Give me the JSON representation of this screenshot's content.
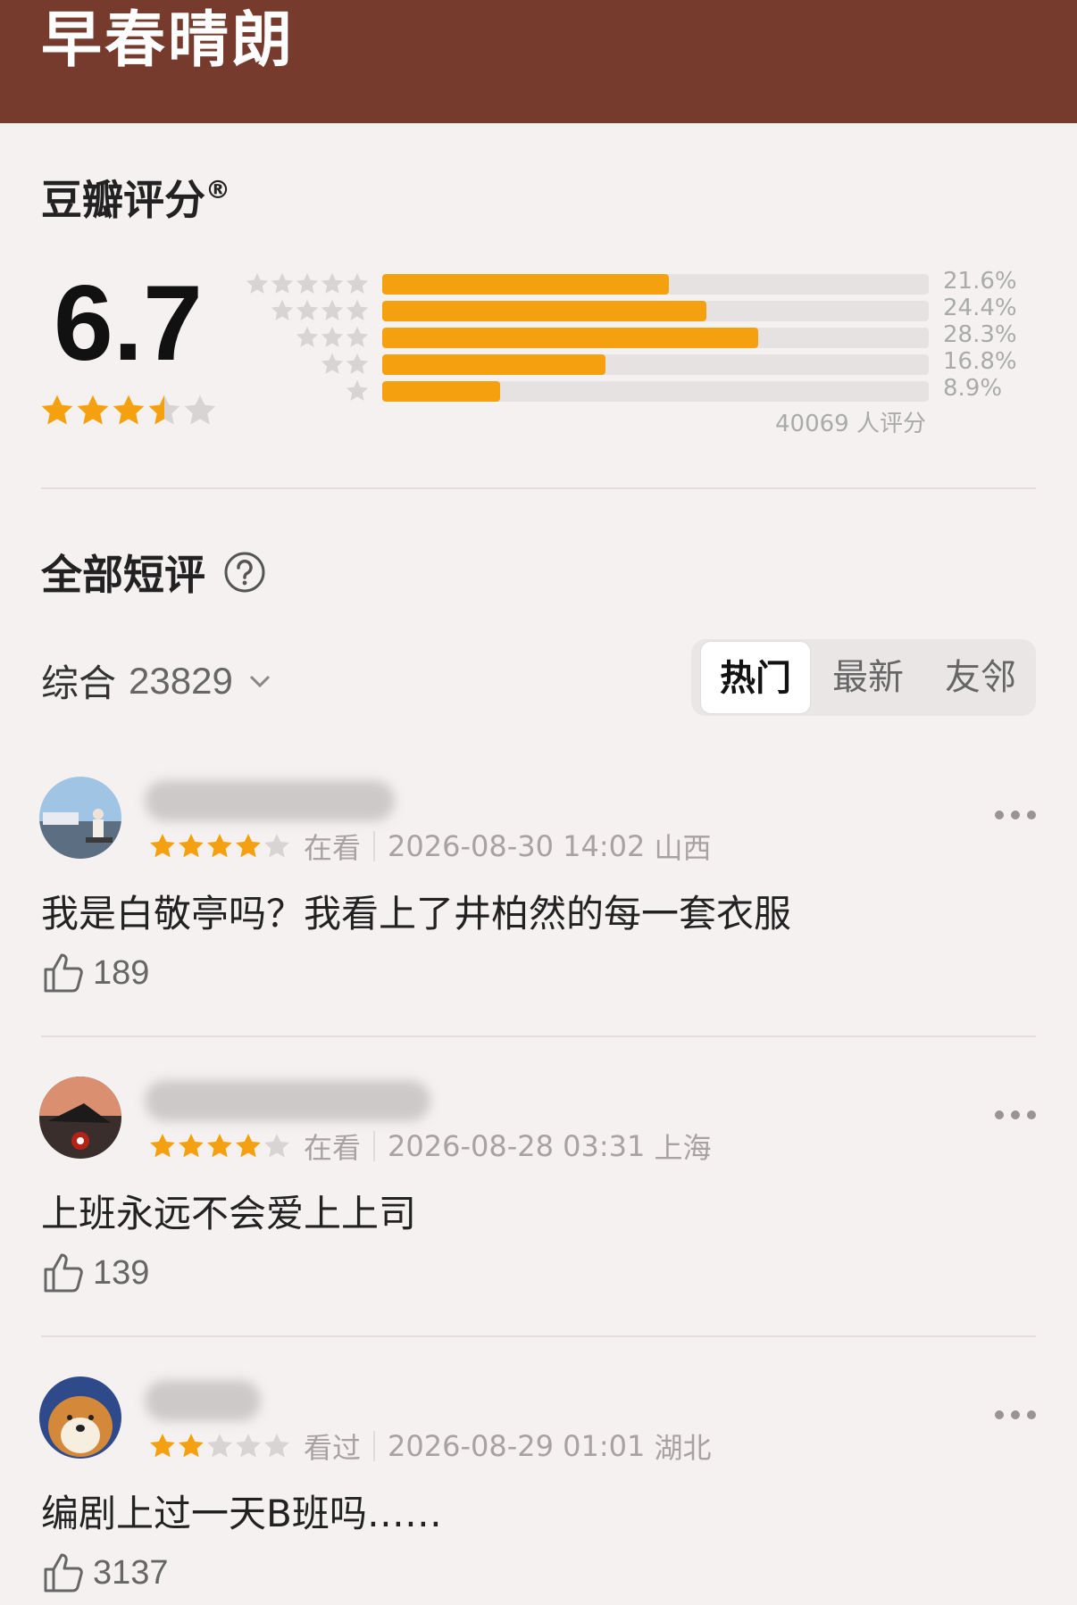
{
  "header": {
    "title": "早春晴朗"
  },
  "rating": {
    "title": "豆瓣评分",
    "reg_mark": "®",
    "score": "6.7",
    "score_stars": 3.5,
    "distribution": [
      {
        "stars": 5,
        "percent": 21.6,
        "label": "21.6%"
      },
      {
        "stars": 4,
        "percent": 24.4,
        "label": "24.4%"
      },
      {
        "stars": 3,
        "percent": 28.3,
        "label": "28.3%"
      },
      {
        "stars": 2,
        "percent": 16.8,
        "label": "16.8%"
      },
      {
        "stars": 1,
        "percent": 8.9,
        "label": "8.9%"
      }
    ],
    "total": "40069 人评分"
  },
  "reviews_section": {
    "title": "全部短评",
    "sort_label": "综合",
    "sort_count": "23829",
    "tabs": [
      "热门",
      "最新",
      "友邻"
    ],
    "active_tab": 0
  },
  "reviews": [
    {
      "stars": 4,
      "status": "在看",
      "datetime": "2026-08-30 14:02",
      "location": "山西",
      "content": "我是白敬亭吗？我看上了井柏然的每一套衣服",
      "likes": "189"
    },
    {
      "stars": 4,
      "status": "在看",
      "datetime": "2026-08-28 03:31",
      "location": "上海",
      "content": "上班永远不会爱上上司",
      "likes": "139"
    },
    {
      "stars": 2,
      "status": "看过",
      "datetime": "2026-08-29 01:01",
      "location": "湖北",
      "content": "编剧上过一天B班吗……",
      "likes": "3137"
    }
  ],
  "colors": {
    "header_bg": "#763b2d",
    "star": "#f5a00f",
    "star_empty": "#d8d4d4",
    "bar": "#f5a00f"
  }
}
